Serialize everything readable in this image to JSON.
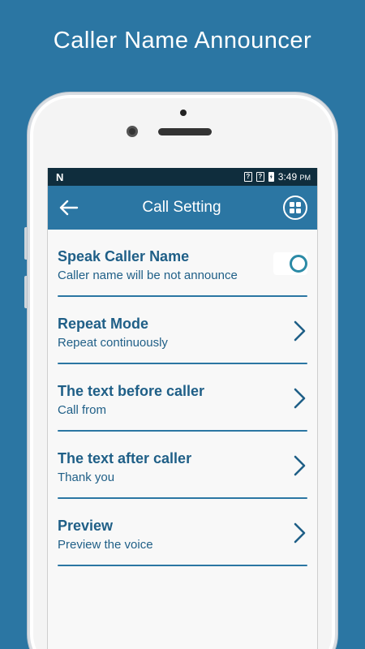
{
  "promo": {
    "title": "Caller Name Announcer"
  },
  "status_bar": {
    "time": "3:49",
    "ampm": "PM",
    "sim1": "?",
    "sim2": "?",
    "notification": "N"
  },
  "toolbar": {
    "title": "Call Setting"
  },
  "settings": [
    {
      "title": "Speak Caller Name",
      "subtitle": "Caller name will be not announce",
      "control": "toggle",
      "toggle_on": false
    },
    {
      "title": "Repeat Mode",
      "subtitle": "Repeat continuously",
      "control": "chevron"
    },
    {
      "title": "The text before caller",
      "subtitle": "Call from",
      "control": "chevron"
    },
    {
      "title": "The text after caller",
      "subtitle": "Thank you",
      "control": "chevron"
    },
    {
      "title": "Preview",
      "subtitle": "Preview the voice",
      "control": "chevron"
    }
  ],
  "colors": {
    "background": "#2b76a3",
    "accent_text": "#1f5f87",
    "status_bar": "#0f2d3d",
    "toggle": "#2b8aa6"
  },
  "icons": {
    "back": "arrow-left-icon",
    "grid": "grid-apps-icon",
    "chevron": "chevron-right-icon"
  }
}
